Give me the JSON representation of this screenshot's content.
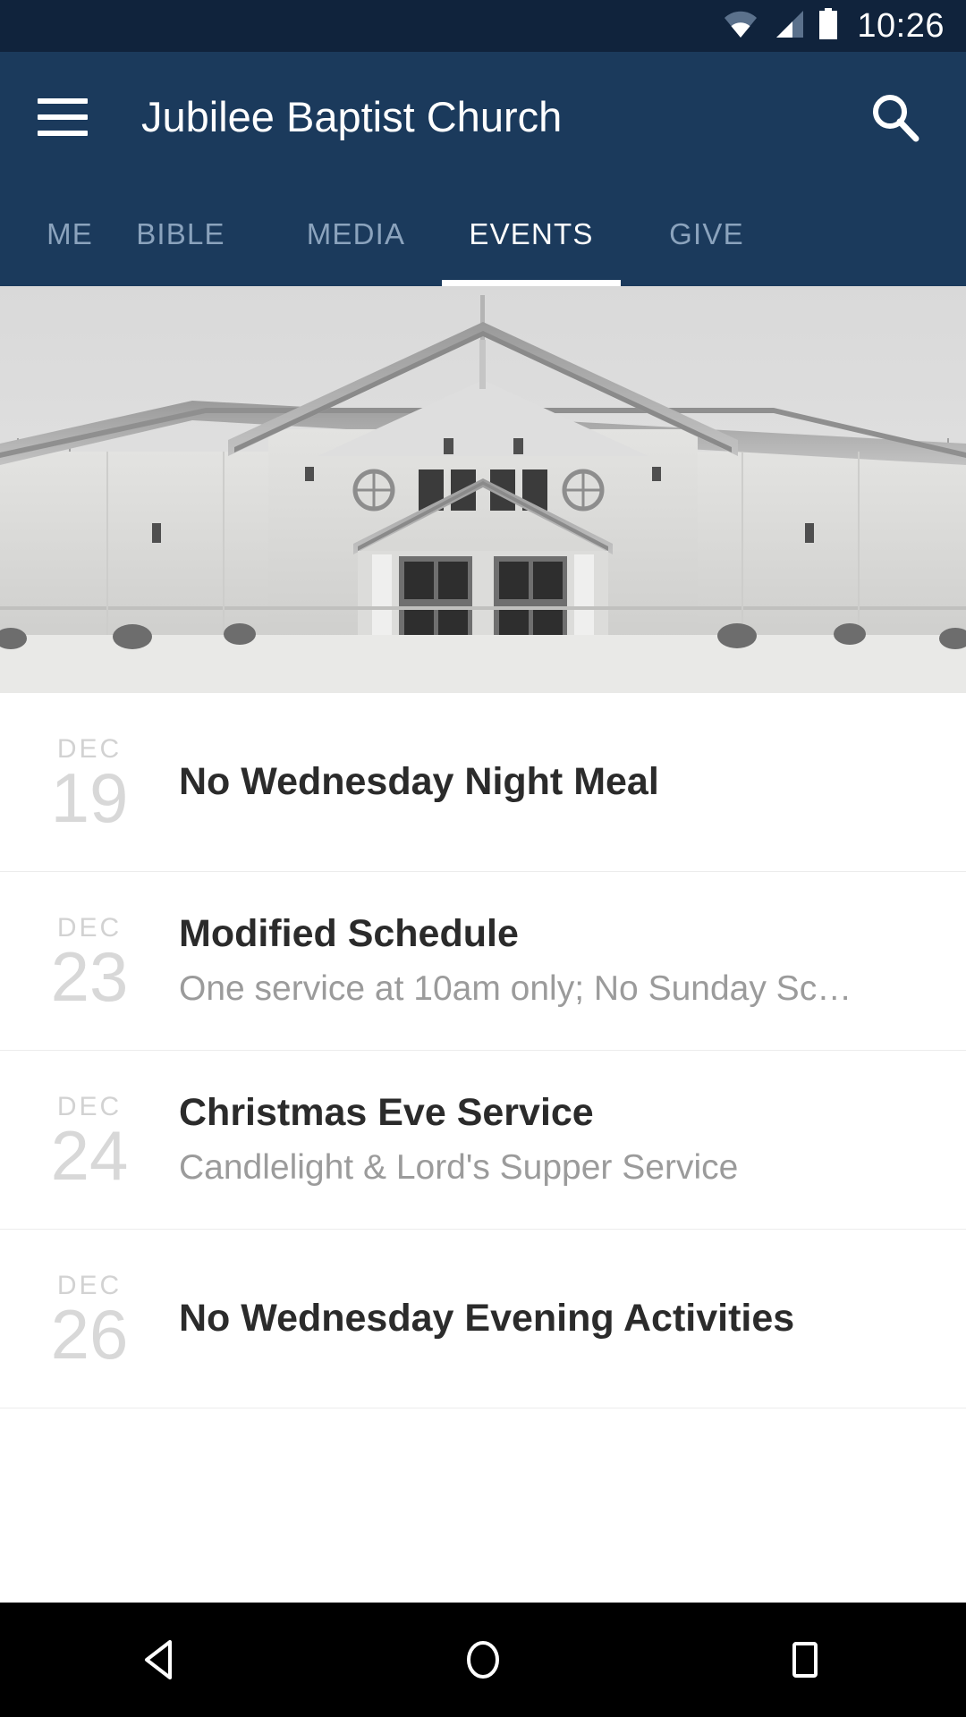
{
  "status_bar": {
    "time": "10:26",
    "icons": [
      "wifi-icon",
      "cellular-signal-icon",
      "battery-icon"
    ],
    "background": "#10233c"
  },
  "app_bar": {
    "title": "Jubilee Baptist Church",
    "menu_icon": "hamburger-menu-icon",
    "search_icon": "search-icon",
    "background": "#1b3a5c",
    "text_color": "#ffffff"
  },
  "tabs": {
    "active_index": 3,
    "inactive_color": "#8ba3bd",
    "active_color": "#ffffff",
    "items": [
      {
        "label": "ME",
        "truncated": true
      },
      {
        "label": "BIBLE",
        "truncated": false
      },
      {
        "label": "MEDIA",
        "truncated": false
      },
      {
        "label": "EVENTS",
        "truncated": false
      },
      {
        "label": "GIVE",
        "truncated": false
      }
    ]
  },
  "hero": {
    "alt": "church-building-photo",
    "grayscale": true
  },
  "events": [
    {
      "month": "DEC",
      "day": "19",
      "title": "No Wednesday Night Meal",
      "subtitle": ""
    },
    {
      "month": "DEC",
      "day": "23",
      "title": "Modified Schedule",
      "subtitle": "One service at 10am only; No Sunday Sc…"
    },
    {
      "month": "DEC",
      "day": "24",
      "title": "Christmas Eve Service",
      "subtitle": "Candlelight & Lord's Supper Service"
    },
    {
      "month": "DEC",
      "day": "26",
      "title": "No Wednesday Evening Activities",
      "subtitle": ""
    }
  ],
  "nav_bar": {
    "background": "#000000",
    "buttons": [
      "back-triangle-icon",
      "home-circle-icon",
      "recents-square-icon"
    ]
  }
}
